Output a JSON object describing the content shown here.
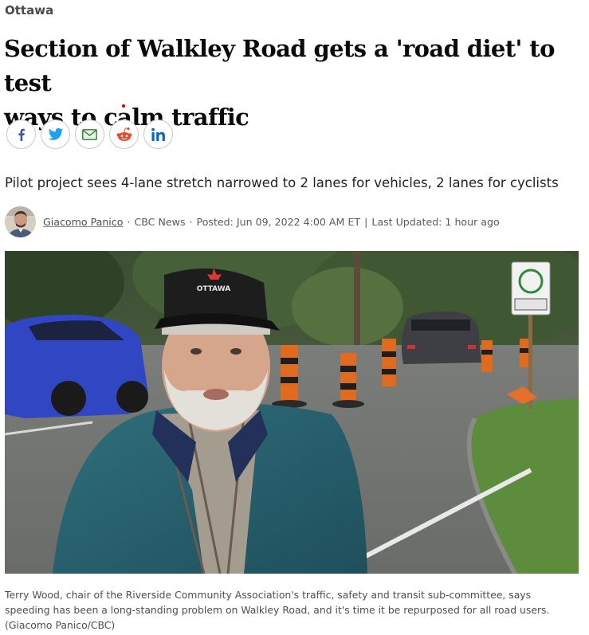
{
  "article": {
    "section": "Ottawa",
    "headline_line1": "Section of Walkley Road gets a 'road diet' to test",
    "headline_line2": "ways to calm traffic",
    "deck": "Pilot project sees 4-lane stretch narrowed to 2 lanes for vehicles, 2 lanes for cyclists",
    "byline": {
      "author": "Giacomo Panico",
      "outlet": "CBC News",
      "posted": "Posted: Jun 09, 2022 4:00 AM ET",
      "updated": "Last Updated: 1 hour ago"
    },
    "share_buttons": [
      {
        "icon": "facebook-icon",
        "color": "#3b5998"
      },
      {
        "icon": "twitter-icon",
        "color": "#1da1f2"
      },
      {
        "icon": "email-icon",
        "color": "#2e7d32"
      },
      {
        "icon": "reddit-icon",
        "color": "#e74c2e"
      },
      {
        "icon": "linkedin-icon",
        "color": "#0a66c2"
      }
    ],
    "photo": {
      "cap_text": "OTTAWA",
      "caption_line1": "Terry Wood, chair of the Riverside Community Association's traffic, safety and transit sub-committee, says",
      "caption_line2": "speeding has been a long-standing problem on Walkley Road, and it's time it be repurposed for all road users.",
      "caption_line3": "(Giacomo Panico/CBC)"
    }
  },
  "colors": {
    "headline": "#0a0a0a",
    "accent_red": "#d40000",
    "byline_text": "#5a5a5a"
  }
}
